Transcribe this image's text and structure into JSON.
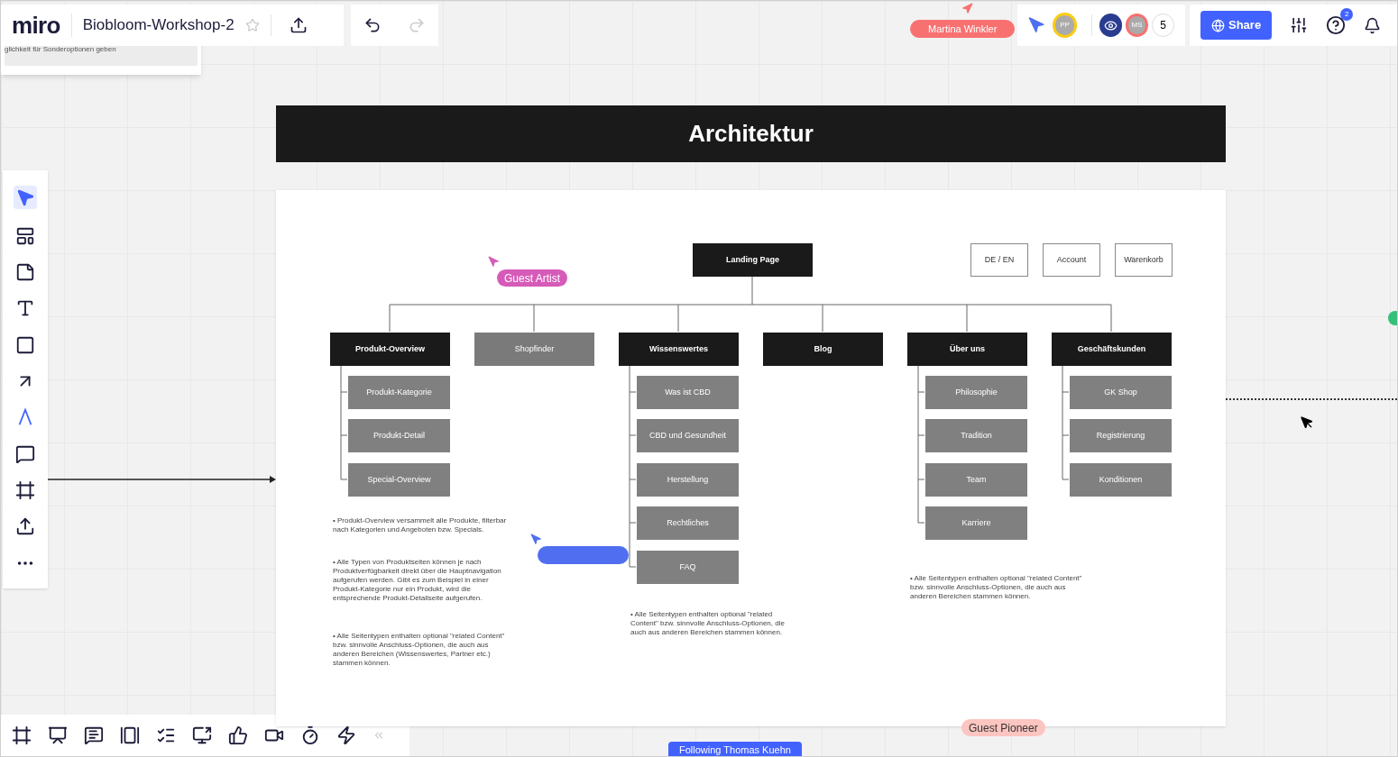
{
  "header": {
    "logo": "miro",
    "board_title": "Biobloom-Workshop-2",
    "starred": false,
    "fragment_text": "glichkeit für Sonderoptionen geben"
  },
  "collaborator_label": {
    "name": "Martina Winkler",
    "color": "#f87171"
  },
  "avatars": [
    {
      "initials": "PP",
      "color": "#facc15"
    },
    {
      "initials": "MS",
      "color": "#f87171"
    }
  ],
  "avatar_count": "5",
  "share_label": "Share",
  "help_badge": "2",
  "tools": [
    {
      "kind": "select",
      "selected": true
    },
    {
      "kind": "templates",
      "selected": false
    },
    {
      "kind": "sticky",
      "selected": false
    },
    {
      "kind": "text",
      "selected": false
    },
    {
      "kind": "shape",
      "selected": false
    },
    {
      "kind": "line",
      "selected": false
    },
    {
      "kind": "pen",
      "selected": false
    },
    {
      "kind": "comment",
      "selected": false
    },
    {
      "kind": "frame",
      "selected": false
    },
    {
      "kind": "upload",
      "selected": false
    },
    {
      "kind": "more",
      "selected": false
    }
  ],
  "bottom_tools": [
    {
      "kind": "frames"
    },
    {
      "kind": "present"
    },
    {
      "kind": "chat"
    },
    {
      "kind": "cards"
    },
    {
      "kind": "list"
    },
    {
      "kind": "share-screen"
    },
    {
      "kind": "vote"
    },
    {
      "kind": "video"
    },
    {
      "kind": "timer"
    },
    {
      "kind": "lightning"
    },
    {
      "kind": "collapse"
    }
  ],
  "frame_title": "Architektur",
  "sitemap": {
    "root": "Landing Page",
    "utility": [
      "DE / EN",
      "Account",
      "Warenkorb"
    ],
    "sections": [
      {
        "label": "Produkt-Overview",
        "kind": "dark",
        "children": [
          "Produkt-Kategorie",
          "Produkt-Detail",
          "Special-Overview"
        ]
      },
      {
        "label": "Shopfinder",
        "kind": "grey"
      },
      {
        "label": "Wissenswertes",
        "kind": "dark",
        "children": [
          "Was ist CBD",
          "CBD und Gesundheit",
          "Herstellung",
          "Rechtliches",
          "FAQ"
        ]
      },
      {
        "label": "Blog",
        "kind": "dark"
      },
      {
        "label": "Über uns",
        "kind": "dark",
        "children": [
          "Philosophie",
          "Tradition",
          "Team",
          "Karriere"
        ]
      },
      {
        "label": "Geschäftskunden",
        "kind": "dark",
        "children": [
          "GK Shop",
          "Registrierung",
          "Konditionen"
        ]
      }
    ]
  },
  "notes": [
    "• Produkt-Overview versammelt alle Produkte, filterbar nach Kategorien und Angeboten bzw. Specials.",
    "• Alle Typen von Produktseiten können je nach Produktverfügbarkeit direkt über die Hauptnavigation aufgerufen werden. Gibt es zum Beispiel in einer Produkt-Kategorie nur ein Produkt, wird die entsprechende Produkt-Detailseite aufgerufen.",
    "• Alle Seitentypen enthalten optional \"related Content\" bzw. sinnvolle Anschluss-Optionen, die auch aus anderen Bereichen (Wissenswertes, Partner etc.) stammen können.",
    "• Alle Seitentypen enthalten optional \"related Content\" bzw. sinnvolle Anschluss-Optionen, die auch aus anderen Bereichen stammen können.",
    "• Alle Seitentypen enthalten optional \"related Content\" bzw. sinnvolle Anschluss-Optionen, die auch aus anderen Bereichen stammen können."
  ],
  "cursors": [
    {
      "name": "Guest Artist",
      "color": "#d65bb8"
    },
    {
      "name": "Guest Pioneer",
      "color": "#fcc5c0"
    }
  ],
  "blank_cursor": {
    "color": "#4f6ff0"
  },
  "following": {
    "label": "Following Thomas Kuehn"
  }
}
